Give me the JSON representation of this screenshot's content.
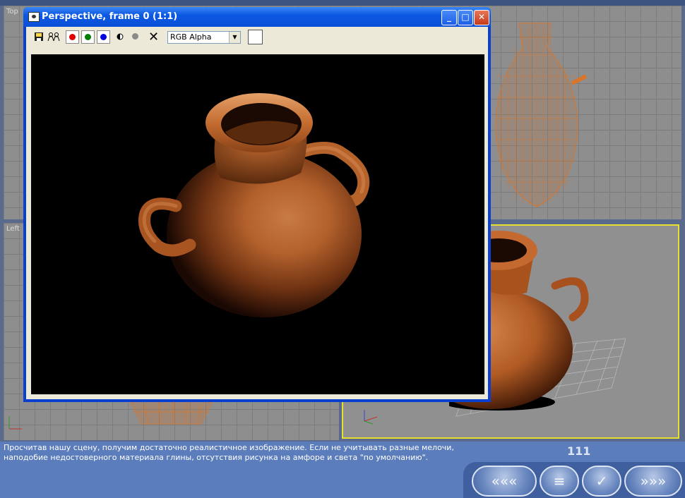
{
  "viewports": {
    "top_label": "Top",
    "left_label": "Left"
  },
  "render_window": {
    "title": "Perspective, frame 0 (1:1)",
    "title_icon": "camera-icon",
    "window_buttons": {
      "minimize": "_",
      "maximize": "□",
      "close": "✕"
    },
    "toolbar": {
      "save_icon": "save-icon",
      "clone_icon": "clone-icon",
      "channels": [
        "red",
        "green",
        "blue"
      ],
      "channel_colors": {
        "red": "#e00000",
        "green": "#008000",
        "blue": "#0000e0"
      },
      "mono_icon": "monochrome-icon",
      "alpha_icon": "alpha-channel-icon",
      "clear_icon": "clear-icon",
      "clear_label": "✕",
      "channel_select": "RGB Alpha",
      "swatch_color": "#ffffff"
    },
    "render_colors": {
      "background": "#000000",
      "clay": "#b8612a"
    }
  },
  "status": {
    "text_line1": "Просчитав нашу сцену, получим достаточно реалистичное изображение. Если не учитывать разные мелочи,",
    "text_line2": "наподобие недостоверного материала глины, отсутствия рисунка на амфоре и света \"по умолчанию\".",
    "page_number": "111"
  },
  "navigation": {
    "back_label": "«««",
    "contents_label": "≡",
    "check_label": "✓",
    "forward_label": "»»»"
  }
}
